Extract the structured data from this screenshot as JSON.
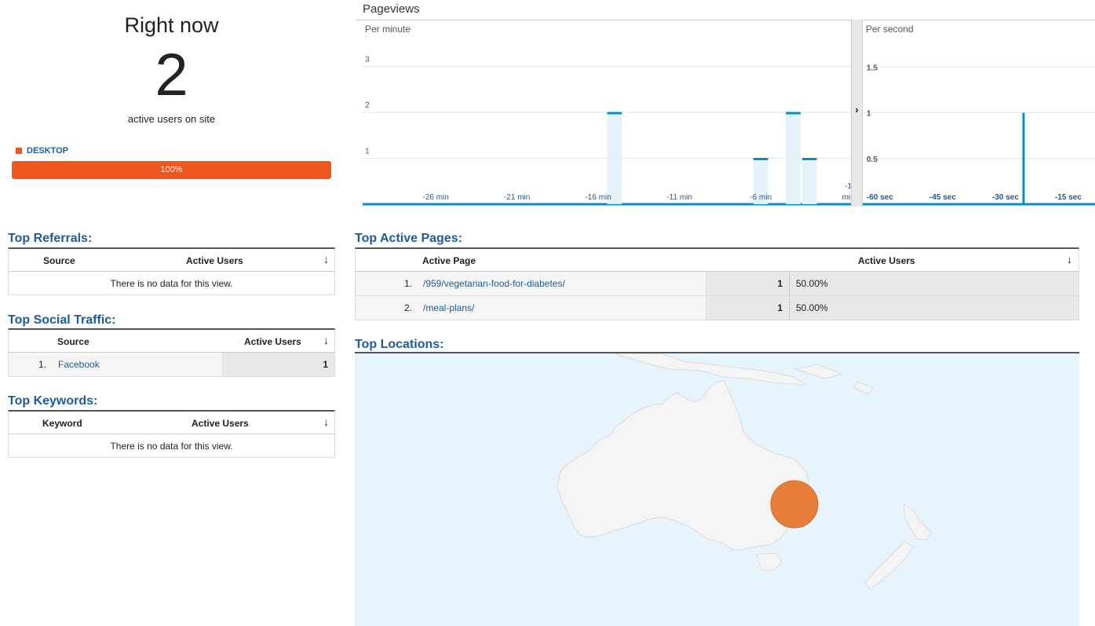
{
  "right_now": {
    "title": "Right now",
    "count": "2",
    "subtitle": "active users on site",
    "device": {
      "label": "DESKTOP",
      "percent_text": "100%",
      "share": 1.0,
      "color": "#ee561f"
    }
  },
  "pageviews": {
    "title": "Pageviews",
    "per_minute_label": "Per minute",
    "per_second_label": "Per second"
  },
  "chart_data": [
    {
      "type": "bar",
      "title": "Per minute",
      "categories": [
        "-30",
        "-29",
        "-28",
        "-27",
        "-26",
        "-25",
        "-24",
        "-23",
        "-22",
        "-21",
        "-20",
        "-19",
        "-18",
        "-17",
        "-16",
        "-15",
        "-14",
        "-13",
        "-12",
        "-11",
        "-10",
        "-9",
        "-8",
        "-7",
        "-6",
        "-5",
        "-4",
        "-3",
        "-2",
        "-1"
      ],
      "values": [
        0,
        0,
        0,
        0,
        0,
        0,
        0,
        0,
        0,
        0,
        0,
        0,
        0,
        0,
        0,
        2,
        0,
        0,
        0,
        0,
        0,
        0,
        0,
        0,
        1,
        0,
        2,
        1,
        0,
        0
      ],
      "x_tick_labels": [
        "-26 min",
        "-21 min",
        "-16 min",
        "-11 min",
        "-6 min",
        "-1 min"
      ],
      "y_tick_labels": [
        "1",
        "2",
        "3"
      ],
      "ylim": [
        0,
        3.5
      ],
      "grid": true,
      "color": "#058dc7"
    },
    {
      "type": "bar",
      "title": "Per second",
      "categories_note": "60 seconds",
      "nonzero": [
        {
          "x": -30,
          "value": 1
        }
      ],
      "x_tick_labels": [
        "-60 sec",
        "-45 sec",
        "-30 sec",
        "-15 sec"
      ],
      "y_tick_labels": [
        "0.5",
        "1",
        "1.5"
      ],
      "ylim": [
        0,
        1.75
      ],
      "grid": true,
      "color": "#058dc7"
    }
  ],
  "top_referrals": {
    "title": "Top Referrals:",
    "col_source": "Source",
    "col_users": "Active Users",
    "sort_icon": "↓",
    "empty": "There is no data for this view."
  },
  "top_social": {
    "title": "Top Social Traffic:",
    "col_source": "Source",
    "col_users": "Active Users",
    "sort_icon": "↓",
    "rows": [
      {
        "index": "1.",
        "source": "Facebook",
        "users": "1"
      }
    ]
  },
  "top_keywords": {
    "title": "Top Keywords:",
    "col_keyword": "Keyword",
    "col_users": "Active Users",
    "sort_icon": "↓",
    "empty": "There is no data for this view."
  },
  "top_pages": {
    "title": "Top Active Pages:",
    "col_page": "Active Page",
    "col_users": "Active Users",
    "sort_icon": "↓",
    "rows": [
      {
        "index": "1.",
        "page": "/959/vegetarian-food-for-diabetes/",
        "users": "1",
        "percent": "50.00%"
      },
      {
        "index": "2.",
        "page": "/meal-plans/",
        "users": "1",
        "percent": "50.00%"
      }
    ]
  },
  "top_locations": {
    "title": "Top Locations:",
    "map": {
      "land_color": "#f4f4f4",
      "sea_color": "#e8f4fb",
      "marker_color": "#e67e3a",
      "markers": [
        {
          "region": "south-east Australia",
          "users": 2
        }
      ]
    }
  }
}
